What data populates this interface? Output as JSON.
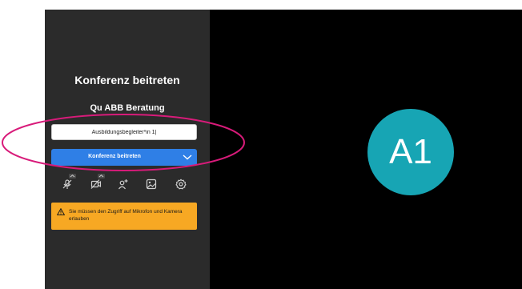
{
  "join_panel": {
    "title": "Konferenz beitreten",
    "meeting_name": "Qu ABB Beratung",
    "name_input": {
      "value": "Ausbildungsbegleiter*in 1|",
      "placeholder": ""
    },
    "join_button_label": "Konferenz beitreten",
    "toolbar": [
      {
        "icon": "microphone-muted-icon",
        "has_dropdown": true
      },
      {
        "icon": "camera-muted-icon",
        "has_dropdown": true
      },
      {
        "icon": "invite-person-icon",
        "has_dropdown": false
      },
      {
        "icon": "background-image-icon",
        "has_dropdown": false
      },
      {
        "icon": "settings-gear-icon",
        "has_dropdown": false
      }
    ],
    "warning": {
      "icon": "warning-triangle-icon",
      "text": "Sie müssen den Zugriff auf Mikrofon und Kamera erlauben"
    }
  },
  "video_area": {
    "avatar_initials": "A1"
  },
  "colors": {
    "panel_bg": "#2b2b2b",
    "video_bg": "#000000",
    "join_button": "#2f7fe6",
    "warning_bg": "#f7a823",
    "avatar_bg": "#17a5b4",
    "annotation_ellipse": "#d81b7a"
  }
}
